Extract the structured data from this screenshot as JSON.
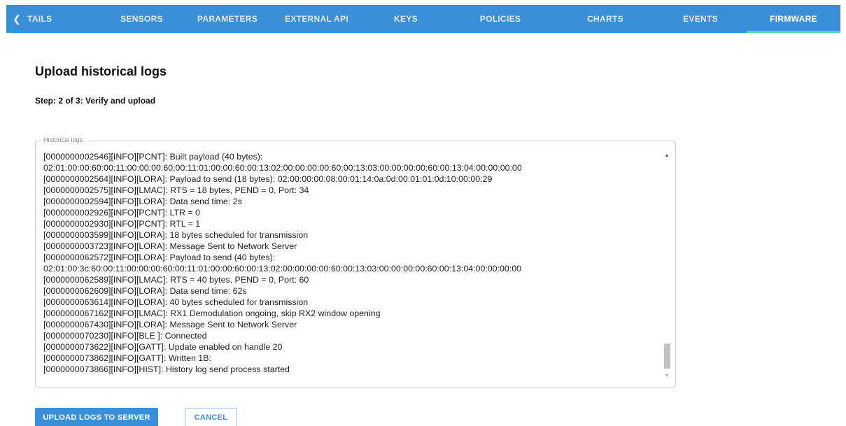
{
  "tabs": {
    "scroll_left_icon": "chevron-left-icon",
    "items": [
      {
        "label": "TAILS"
      },
      {
        "label": "SENSORS"
      },
      {
        "label": "PARAMETERS"
      },
      {
        "label": "EXTERNAL API"
      },
      {
        "label": "KEYS"
      },
      {
        "label": "POLICIES"
      },
      {
        "label": "CHARTS"
      },
      {
        "label": "EVENTS"
      },
      {
        "label": "FIRMWARE"
      }
    ],
    "active": "FIRMWARE",
    "colors": {
      "bar": "#3b8fd9",
      "indicator": "#5fd38f"
    }
  },
  "page": {
    "title": "Upload historical logs",
    "step": "Step: 2 of 3: Verify and upload"
  },
  "logs": {
    "legend": "Historical logs:",
    "lines": [
      "[0000000002546][INFO][PCNT]: Built payload (40 bytes):",
      "02:01:00:00:60:00:11:00:00:00:60:00:11:01:00:00:60:00:13:02:00:00:00:00:60:00:13:03:00:00:00:00:60:00:13:04:00:00:00:00",
      "[0000000002564][INFO][LORA]: Payload to send (18 bytes): 02:00:00:00:08:00:01:14:0a:0d:00:01:01:0d:10:00:00:29",
      "[0000000002575][INFO][LMAC]: RTS = 18 bytes, PEND = 0, Port: 34",
      "[0000000002594][INFO][LORA]: Data send time: 2s",
      "[0000000002926][INFO][PCNT]: LTR = 0",
      "[0000000002930][INFO][PCNT]: RTL = 1",
      "[0000000003599][INFO][LORA]: 18 bytes scheduled for transmission",
      "[0000000003723][INFO][LORA]: Message Sent to Network Server",
      "[0000000062572][INFO][LORA]: Payload to send (40 bytes):",
      "02:01:00:3c:60:00:11:00:00:00:60:00:11:01:00:00:60:00:13:02:00:00:00:00:60:00:13:03:00:00:00:00:60:00:13:04:00:00:00:00",
      "[0000000062589][INFO][LMAC]: RTS = 40 bytes, PEND = 0, Port: 60",
      "[0000000062609][INFO][LORA]: Data send time: 62s",
      "[0000000063614][INFO][LORA]: 40 bytes scheduled for transmission",
      "[0000000067162][INFO][LMAC]: RX1 Demodulation ongoing, skip RX2 window opening",
      "[0000000067430][INFO][LORA]: Message Sent to Network Server",
      "[0000000070230][INFO][BLE ]: Connected",
      "[0000000073622][INFO][GATT]: Update enabled on handle 20",
      "[0000000073862][INFO][GATT]: Written 1B:",
      "[0000000073866][INFO][HIST]: History log send process started"
    ]
  },
  "actions": {
    "upload_label": "UPLOAD LOGS TO SERVER",
    "cancel_label": "CANCEL"
  }
}
